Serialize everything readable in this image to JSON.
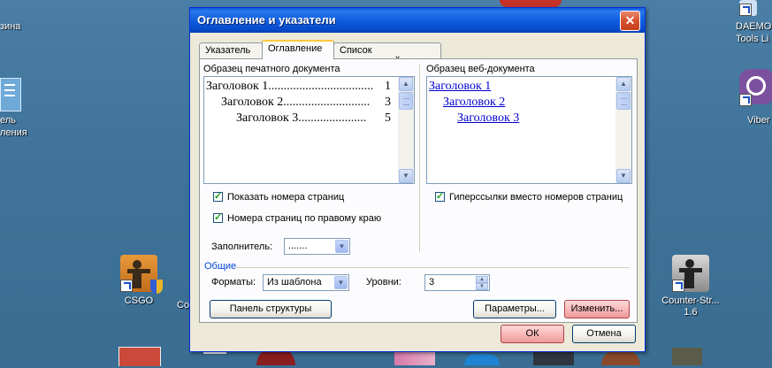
{
  "colors": {
    "accent": "#0a5ad8",
    "desktop": "#3f7399",
    "pink_button": "#f6b3b3",
    "link": "#0000cc"
  },
  "desktop": {
    "left_top_partial": "зина",
    "left_mid_partial_1": "ель",
    "left_mid_partial_2": "ления",
    "right_top_1": "DAEMO",
    "right_top_2": "Tools Li",
    "right_viber": "Viber",
    "csgo": "CSGO",
    "co_partial": "Co",
    "counter_strike_1": "Counter-Str...",
    "counter_strike_2": "1.6"
  },
  "dialog": {
    "title": "Оглавление и указатели",
    "close": "✕",
    "tabs": [
      "Указатель",
      "Оглавление",
      "Список иллюстраций"
    ],
    "print_preview": {
      "label": "Образец печатного документа",
      "entries": [
        {
          "text": "Заголовок 1",
          "dots": "..................................",
          "page": "1"
        },
        {
          "text": "Заголовок 2",
          "dots": "............................",
          "page": "3"
        },
        {
          "text": "Заголовок 3",
          "dots": "......................",
          "page": "5"
        }
      ]
    },
    "web_preview": {
      "label": "Образец веб-документа",
      "entries": [
        "Заголовок 1",
        "Заголовок 2",
        "Заголовок 3"
      ]
    },
    "show_page_numbers": "Показать номера страниц",
    "right_align_numbers": "Номера страниц по правому краю",
    "hyperlinks": "Гиперссылки вместо номеров страниц",
    "leader_label": "Заполнитель:",
    "leader_value": ".......",
    "general_label": "Общие",
    "formats_label": "Форматы:",
    "formats_value": "Из шаблона",
    "levels_label": "Уровни:",
    "levels_value": "3",
    "outline_button": "Панель структуры",
    "options_button": "Параметры...",
    "modify_button": "Изменить...",
    "ok_button": "ОК",
    "cancel_button": "Отмена"
  }
}
